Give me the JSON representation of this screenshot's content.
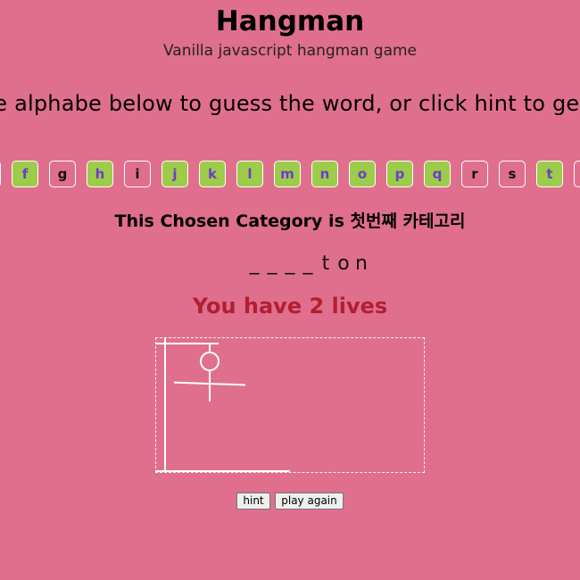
{
  "header": {
    "title": "Hangman",
    "subtitle": "Vanilla javascript hangman game"
  },
  "instructions": "he alphabe below to guess the word, or click hint to ge a",
  "alphabet": {
    "letters": [
      {
        "char": "e",
        "state": "used"
      },
      {
        "char": "f",
        "state": "unused"
      },
      {
        "char": "g",
        "state": "used"
      },
      {
        "char": "h",
        "state": "unused"
      },
      {
        "char": "i",
        "state": "used"
      },
      {
        "char": "j",
        "state": "unused"
      },
      {
        "char": "k",
        "state": "unused"
      },
      {
        "char": "l",
        "state": "unused"
      },
      {
        "char": "m",
        "state": "unused"
      },
      {
        "char": "n",
        "state": "unused"
      },
      {
        "char": "o",
        "state": "unused"
      },
      {
        "char": "p",
        "state": "unused"
      },
      {
        "char": "q",
        "state": "unused"
      },
      {
        "char": "r",
        "state": "used"
      },
      {
        "char": "s",
        "state": "used"
      },
      {
        "char": "t",
        "state": "unused"
      },
      {
        "char": "u",
        "state": "used"
      }
    ]
  },
  "category": "This Chosen Category is 첫번째 카테고리",
  "word": [
    "_",
    "_",
    "_",
    "_",
    "t",
    "o",
    "n"
  ],
  "lives": "You have 2 lives",
  "buttons": {
    "hint": "hint",
    "play_again": "play again"
  },
  "colors": {
    "background": "#e06f8e",
    "letter_unused_bg": "#9ccc4a",
    "letter_unused_text": "#6a3ec8",
    "lives_text": "#b02030"
  }
}
